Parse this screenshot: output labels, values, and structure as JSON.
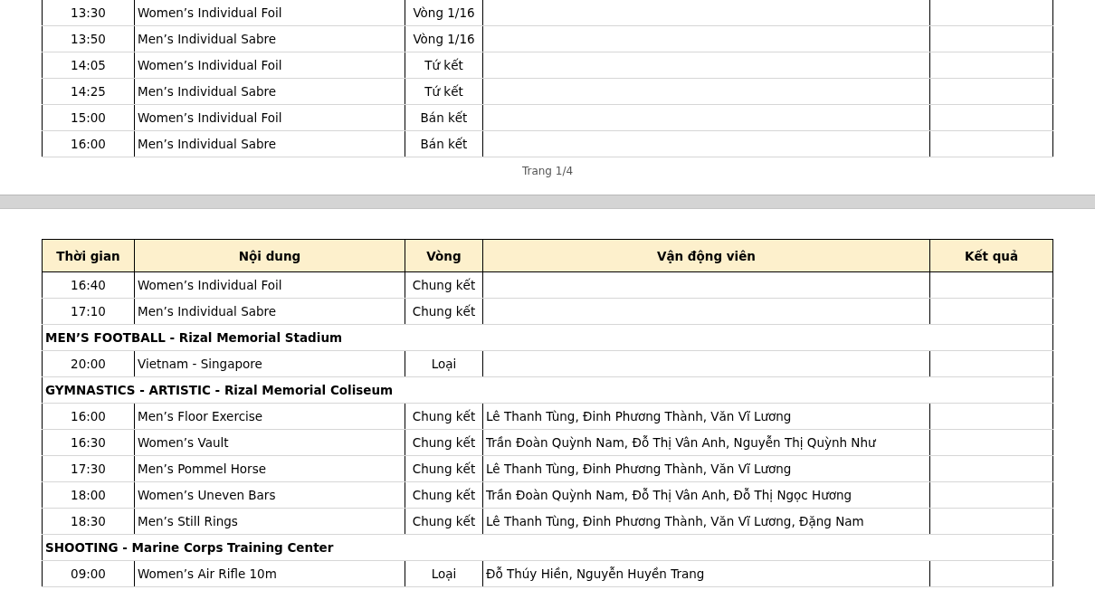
{
  "pages": [
    {
      "rows": [
        {
          "kind": "event",
          "time": "13:30",
          "event": "Women’s Individual Foil",
          "round": "Vòng 1/16"
        },
        {
          "kind": "event",
          "time": "13:50",
          "event": "Men’s Individual Sabre",
          "round": "Vòng 1/16"
        },
        {
          "kind": "event",
          "time": "14:05",
          "event": "Women’s Individual Foil",
          "round": "Tứ kết"
        },
        {
          "kind": "event",
          "time": "14:25",
          "event": "Men’s Individual Sabre",
          "round": "Tứ kết"
        },
        {
          "kind": "event",
          "time": "15:00",
          "event": "Women’s Individual Foil",
          "round": "Bán kết"
        },
        {
          "kind": "event",
          "time": "16:00",
          "event": "Men’s Individual Sabre",
          "round": "Bán kết"
        }
      ],
      "page_label": "Trang 1/4"
    },
    {
      "columns": [
        "Thời gian",
        "Nội dung",
        "Vòng",
        "Vận động viên",
        "Kết quả"
      ],
      "rows": [
        {
          "kind": "event",
          "time": "16:40",
          "event": "Women’s Individual Foil",
          "round": "Chung kết"
        },
        {
          "kind": "event",
          "time": "17:10",
          "event": "Men’s Individual Sabre",
          "round": "Chung kết"
        },
        {
          "kind": "section",
          "title": "MEN’S FOOTBALL - Rizal Memorial Stadium"
        },
        {
          "kind": "event",
          "time": "20:00",
          "event": "Vietnam - Singapore",
          "round": "Loại"
        },
        {
          "kind": "section",
          "title": "GYMNASTICS - ARTISTIC - Rizal Memorial Coliseum"
        },
        {
          "kind": "event",
          "time": "16:00",
          "event": "Men’s Floor Exercise",
          "round": "Chung kết",
          "athletes": "Lê Thanh Tùng, Đinh Phương Thành, Văn Vĩ Lương"
        },
        {
          "kind": "event",
          "time": "16:30",
          "event": "Women’s Vault",
          "round": "Chung kết",
          "athletes": "Trần Đoàn Quỳnh Nam, Đỗ Thị Vân Anh, Nguyễn Thị Quỳnh Như"
        },
        {
          "kind": "event",
          "time": "17:30",
          "event": "Men’s Pommel Horse",
          "round": "Chung kết",
          "athletes": "Lê Thanh Tùng, Đinh Phương Thành, Văn Vĩ Lương"
        },
        {
          "kind": "event",
          "time": "18:00",
          "event": "Women’s Uneven Bars",
          "round": "Chung kết",
          "athletes": "Trần Đoàn Quỳnh Nam, Đỗ Thị Vân Anh, Đỗ Thị Ngọc Hương"
        },
        {
          "kind": "event",
          "time": "18:30",
          "event": "Men’s Still Rings",
          "round": "Chung kết",
          "athletes": "Lê Thanh Tùng, Đinh Phương Thành, Văn Vĩ Lương, Đặng Nam"
        },
        {
          "kind": "section",
          "title": "SHOOTING - Marine Corps Training Center"
        },
        {
          "kind": "event",
          "time": "09:00",
          "event": "Women’s Air Rifle 10m",
          "round": "Loại",
          "athletes": "Đỗ Thúy Hiền, Nguyễn Huyền Trang"
        }
      ]
    }
  ]
}
